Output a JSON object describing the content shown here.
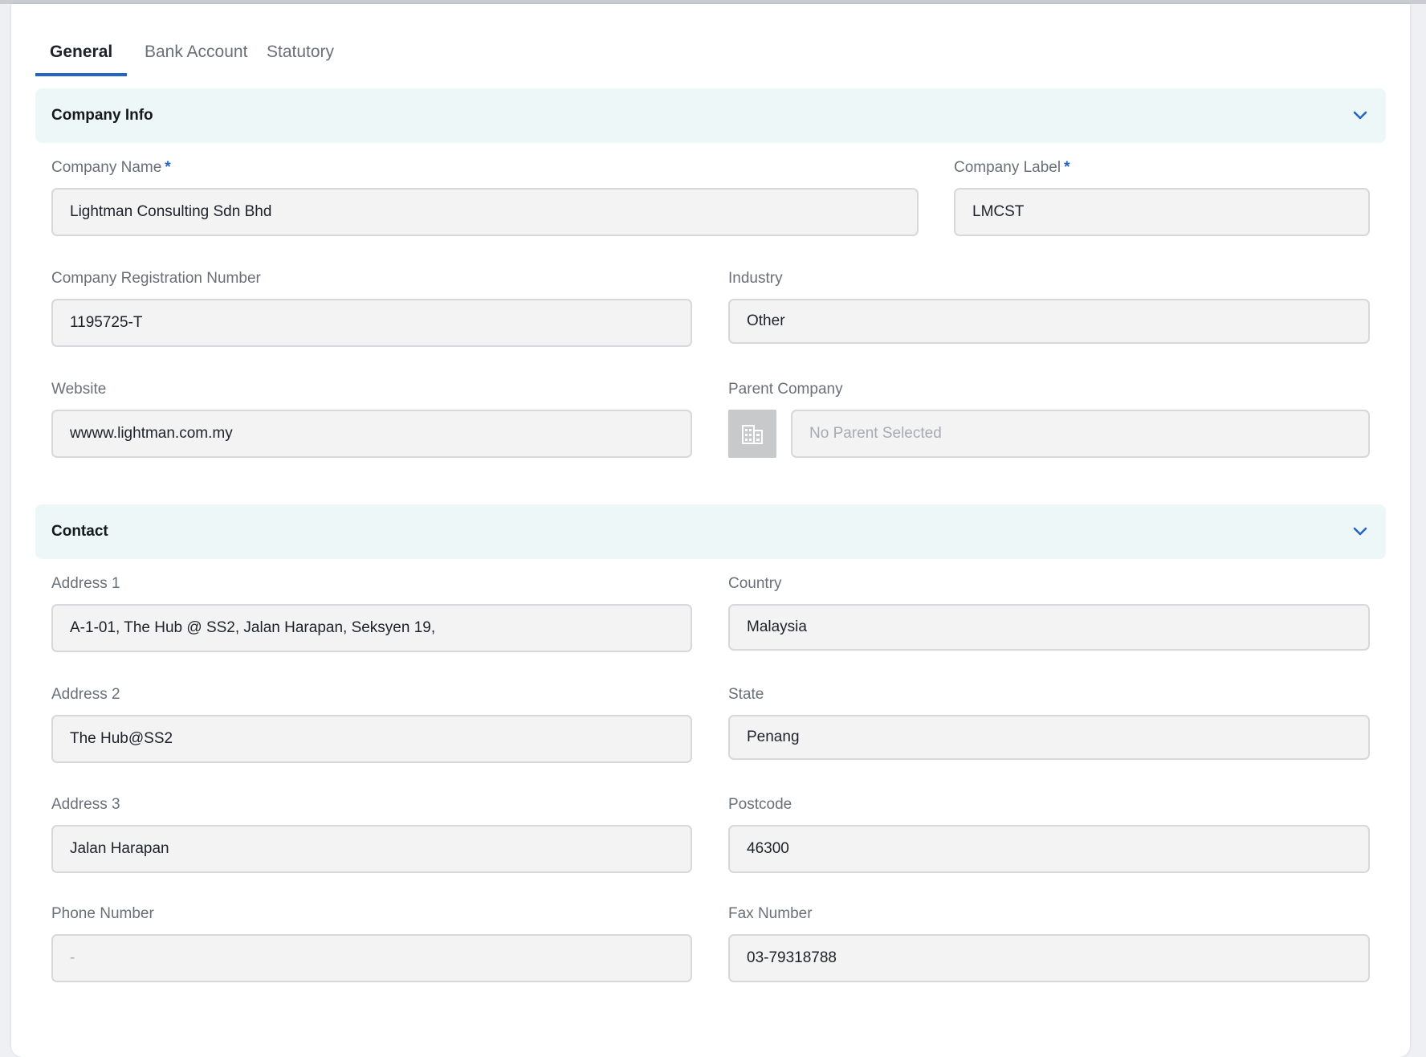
{
  "tabs": [
    {
      "label": "General",
      "active": true
    },
    {
      "label": "Bank Account",
      "active": false
    },
    {
      "label": "Statutory",
      "active": false
    }
  ],
  "sections": {
    "company_info": {
      "title": "Company Info",
      "fields": {
        "company_name": {
          "label": "Company Name",
          "required_mark": "*",
          "value": "Lightman Consulting Sdn Bhd"
        },
        "company_label": {
          "label": "Company Label",
          "required_mark": "*",
          "value": "LMCST"
        },
        "registration_number": {
          "label": "Company Registration Number",
          "value": "1195725-T"
        },
        "industry": {
          "label": "Industry",
          "value": "Other"
        },
        "website": {
          "label": "Website",
          "value": "wwww.lightman.com.my"
        },
        "parent_company": {
          "label": "Parent Company",
          "placeholder": "No Parent Selected",
          "icon": "building-icon"
        }
      }
    },
    "contact": {
      "title": "Contact",
      "fields": {
        "address1": {
          "label": "Address 1",
          "value": "A-1-01, The Hub @ SS2, Jalan Harapan, Seksyen 19,"
        },
        "country": {
          "label": "Country",
          "value": "Malaysia"
        },
        "address2": {
          "label": "Address 2",
          "value": "The Hub@SS2"
        },
        "state": {
          "label": "State",
          "value": "Penang"
        },
        "address3": {
          "label": "Address 3",
          "value": "Jalan Harapan"
        },
        "postcode": {
          "label": "Postcode",
          "value": "46300"
        },
        "phone": {
          "label": "Phone Number",
          "placeholder": "-"
        },
        "fax": {
          "label": "Fax Number",
          "value": "03-79318788"
        }
      }
    }
  },
  "colors": {
    "accent": "#2563c9",
    "section_bg": "#edf7f7",
    "field_bg": "#f3f3f4",
    "label": "#6a6f78"
  }
}
